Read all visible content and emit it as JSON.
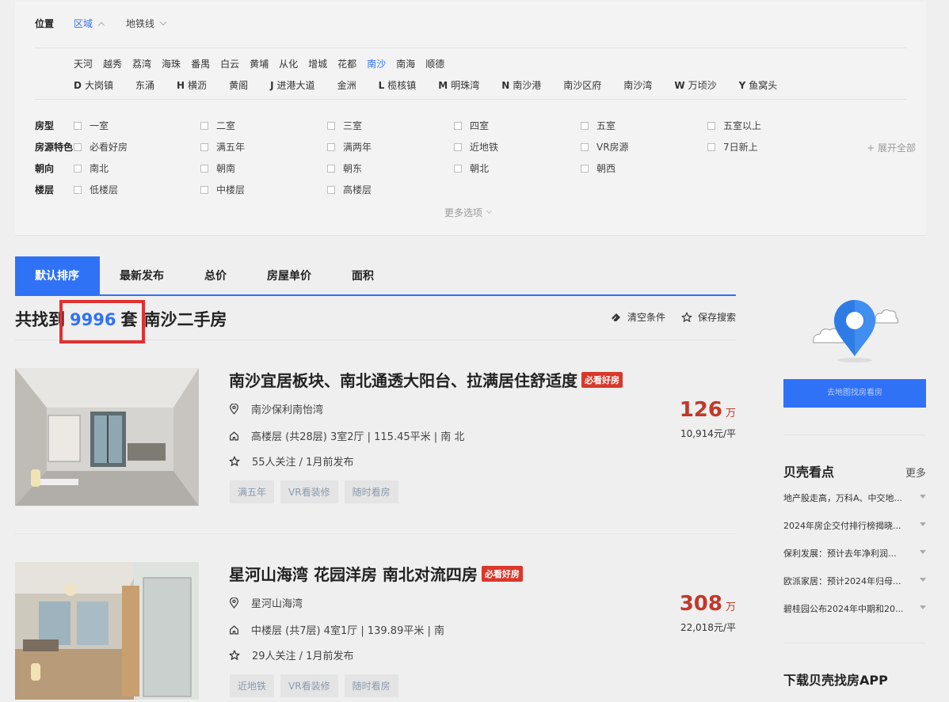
{
  "filters": {
    "location_label": "位置",
    "tabs": [
      {
        "label": "区域",
        "active": true
      },
      {
        "label": "地铁线",
        "active": false
      }
    ],
    "districts": [
      "天河",
      "越秀",
      "荔湾",
      "海珠",
      "番禺",
      "白云",
      "黄埔",
      "从化",
      "增城",
      "花都",
      "南沙",
      "南海",
      "顺德"
    ],
    "active_district": "南沙",
    "subareas": [
      {
        "letter": "D",
        "name": "大岗镇"
      },
      {
        "letter": "",
        "name": "东涌"
      },
      {
        "letter": "H",
        "name": "横沥"
      },
      {
        "letter": "",
        "name": "黄阁"
      },
      {
        "letter": "J",
        "name": "进港大道"
      },
      {
        "letter": "",
        "name": "金洲"
      },
      {
        "letter": "L",
        "name": "榄核镇"
      },
      {
        "letter": "M",
        "name": "明珠湾"
      },
      {
        "letter": "N",
        "name": "南沙港"
      },
      {
        "letter": "",
        "name": "南沙区府"
      },
      {
        "letter": "",
        "name": "南沙湾"
      },
      {
        "letter": "W",
        "name": "万顷沙"
      },
      {
        "letter": "Y",
        "name": "鱼窝头"
      }
    ],
    "rows": [
      {
        "label": "房型",
        "options": [
          "一室",
          "二室",
          "三室",
          "四室",
          "五室",
          "五室以上"
        ]
      },
      {
        "label": "房源特色",
        "options": [
          "必看好房",
          "满五年",
          "满两年",
          "近地铁",
          "VR房源",
          "7日新上"
        ]
      },
      {
        "label": "朝向",
        "options": [
          "南北",
          "朝南",
          "朝东",
          "朝北",
          "朝西"
        ]
      },
      {
        "label": "楼层",
        "options": [
          "低楼层",
          "中楼层",
          "高楼层"
        ]
      }
    ],
    "expand_all": "+ 展开全部",
    "more_options": "更多选项"
  },
  "sort": {
    "tabs": [
      "默认排序",
      "最新发布",
      "总价",
      "房屋单价",
      "面积"
    ],
    "active": "默认排序"
  },
  "summary": {
    "prefix": "共找到",
    "count": "9996",
    "suffix": "套",
    "area_text": "南沙二手房",
    "clear_label": "清空条件",
    "save_label": "保存搜索"
  },
  "listings": [
    {
      "title": "南沙宜居板块、南北通透大阳台、拉满居住舒适度",
      "badge": "必看好房",
      "community": "南沙保利南怡湾",
      "house_info": "高楼层 (共28层) 3室2厅 | 115.45平米 | 南 北",
      "follow_info": "55人关注 / 1月前发布",
      "tags": [
        "满五年",
        "VR看装修",
        "随时看房"
      ],
      "total_price": "126",
      "price_unit": "万",
      "unit_price": "10,914元/平"
    },
    {
      "title": "星河山海湾 花园洋房 南北对流四房",
      "badge": "必看好房",
      "community": "星河山海湾",
      "house_info": "中楼层 (共7层) 4室1厅 | 139.89平米 | 南",
      "follow_info": "29人关注 / 1月前发布",
      "tags": [
        "近地铁",
        "VR看装修",
        "随时看房"
      ],
      "total_price": "308",
      "price_unit": "万",
      "unit_price": "22,018元/平"
    }
  ],
  "sidebar": {
    "button_text": "去地图找房看房",
    "news_title": "贝壳看点",
    "news_more": "更多",
    "news": [
      "地产股走高，万科A、中交地...",
      "2024年房企交付排行榜揭晓...",
      "保利发展：预计去年净利润...",
      "欧派家居：预计2024年归母...",
      "碧桂园公布2024年中期和20..."
    ],
    "app_download": "下载贝壳找房APP"
  },
  "colors": {
    "accent": "#3072f6",
    "price": "#c0392b",
    "badge": "#d9382b",
    "highlight_box": "#e03030"
  }
}
